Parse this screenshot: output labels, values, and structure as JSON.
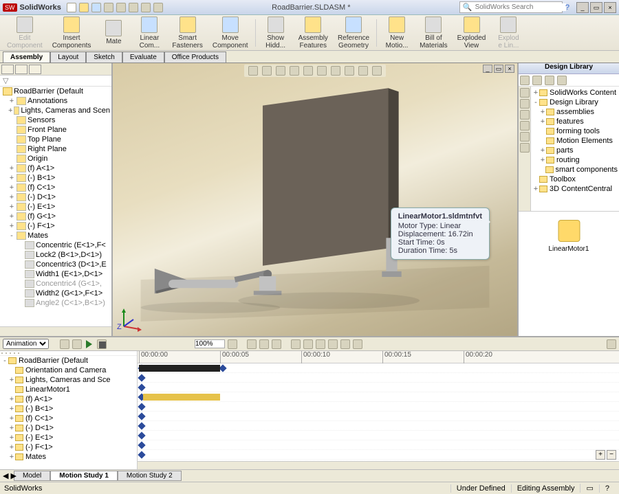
{
  "app": {
    "name": "SolidWorks",
    "title": "RoadBarrier.SLDASM *"
  },
  "search": {
    "placeholder": "SolidWorks Search"
  },
  "ribbon": [
    {
      "label": "Edit\nComponent",
      "dis": true
    },
    {
      "label": "Insert\nComponents"
    },
    {
      "label": "Mate"
    },
    {
      "label": "Linear\nCom..."
    },
    {
      "label": "Smart\nFasteners"
    },
    {
      "label": "Move\nComponent"
    },
    {
      "label": "Show\nHidd..."
    },
    {
      "label": "Assembly\nFeatures"
    },
    {
      "label": "Reference\nGeometry"
    },
    {
      "label": "New\nMotio..."
    },
    {
      "label": "Bill of\nMaterials"
    },
    {
      "label": "Exploded\nView"
    },
    {
      "label": "Explod\ne Lin...",
      "dis": true
    }
  ],
  "tabs": [
    "Assembly",
    "Layout",
    "Sketch",
    "Evaluate",
    "Office Products"
  ],
  "tree": {
    "root": "RoadBarrier (Default<Default",
    "items": [
      {
        "t": "Annotations",
        "e": "+",
        "lvl": 1
      },
      {
        "t": "Lights, Cameras and Scen",
        "e": "+",
        "lvl": 1
      },
      {
        "t": "Sensors",
        "lvl": 1
      },
      {
        "t": "Front Plane",
        "lvl": 1
      },
      {
        "t": "Top Plane",
        "lvl": 1
      },
      {
        "t": "Right Plane",
        "lvl": 1
      },
      {
        "t": "Origin",
        "lvl": 1
      },
      {
        "t": "(f) A<1>",
        "e": "+",
        "lvl": 1
      },
      {
        "t": "(-) B<1>",
        "e": "+",
        "lvl": 1
      },
      {
        "t": "(f) C<1>",
        "e": "+",
        "lvl": 1
      },
      {
        "t": "(-) D<1>",
        "e": "+",
        "lvl": 1
      },
      {
        "t": "(-) E<1>",
        "e": "+",
        "lvl": 1
      },
      {
        "t": "(f) G<1>",
        "e": "+",
        "lvl": 1
      },
      {
        "t": "(-) F<1>",
        "e": "+",
        "lvl": 1
      },
      {
        "t": "Mates",
        "e": "-",
        "lvl": 1
      },
      {
        "t": "Concentric (E<1>,F<",
        "lvl": 2
      },
      {
        "t": "Lock2 (B<1>,D<1>)",
        "lvl": 2
      },
      {
        "t": "Concentric3 (D<1>,E",
        "lvl": 2
      },
      {
        "t": "Width1 (E<1>,D<1>",
        "lvl": 2
      },
      {
        "t": "Concentric4 (G<1>,",
        "lvl": 2,
        "dim": true
      },
      {
        "t": "Width2 (G<1>,F<1>",
        "lvl": 2
      },
      {
        "t": "Angle2 (C<1>,B<1>)",
        "lvl": 2,
        "dim": true
      }
    ]
  },
  "tooltip": {
    "title": "LinearMotor1.sldmtnfvt",
    "l1": "Motor Type: Linear",
    "l2": "Displacement: 16.72in",
    "l3": "Start Time: 0s",
    "l4": "Duration Time: 5s"
  },
  "preview_label": "LinearMotor1",
  "dl": {
    "title": "Design Library",
    "items": [
      {
        "t": "SolidWorks Content",
        "e": "+",
        "lvl": 0
      },
      {
        "t": "Design Library",
        "e": "-",
        "lvl": 0
      },
      {
        "t": "assemblies",
        "e": "+",
        "lvl": 1
      },
      {
        "t": "features",
        "e": "+",
        "lvl": 1
      },
      {
        "t": "forming tools",
        "lvl": 1
      },
      {
        "t": "Motion Elements",
        "lvl": 1
      },
      {
        "t": "parts",
        "e": "+",
        "lvl": 1
      },
      {
        "t": "routing",
        "e": "+",
        "lvl": 1
      },
      {
        "t": "smart components",
        "lvl": 1
      },
      {
        "t": "Toolbox",
        "lvl": 0
      },
      {
        "t": "3D ContentCentral",
        "e": "+",
        "lvl": 0,
        "dim": true
      }
    ]
  },
  "motion": {
    "type_label": "Animation",
    "zoom": "100%",
    "ticks": [
      "00:00:00",
      "00:00:05",
      "00:00:10",
      "00:00:15",
      "00:00:20"
    ],
    "tree": [
      {
        "t": "RoadBarrier (Default<Defa",
        "e": "-",
        "lvl": 0
      },
      {
        "t": "Orientation and Camera",
        "lvl": 1
      },
      {
        "t": "Lights, Cameras and Sce",
        "e": "+",
        "lvl": 1
      },
      {
        "t": "LinearMotor1",
        "lvl": 1
      },
      {
        "t": "(f) A<1>",
        "e": "+",
        "lvl": 1
      },
      {
        "t": "(-) B<1>",
        "e": "+",
        "lvl": 1
      },
      {
        "t": "(f) C<1>",
        "e": "+",
        "lvl": 1
      },
      {
        "t": "(-) D<1>",
        "e": "+",
        "lvl": 1
      },
      {
        "t": "(-) E<1>",
        "e": "+",
        "lvl": 1
      },
      {
        "t": "(-) F<1>",
        "e": "+",
        "lvl": 1
      },
      {
        "t": "Mates",
        "e": "+",
        "lvl": 1,
        "dim": true
      }
    ],
    "tabs": [
      "Model",
      "Motion Study 1",
      "Motion Study 2"
    ]
  },
  "status": {
    "left": "SolidWorks",
    "mid": "Under Defined",
    "right": "Editing Assembly"
  }
}
